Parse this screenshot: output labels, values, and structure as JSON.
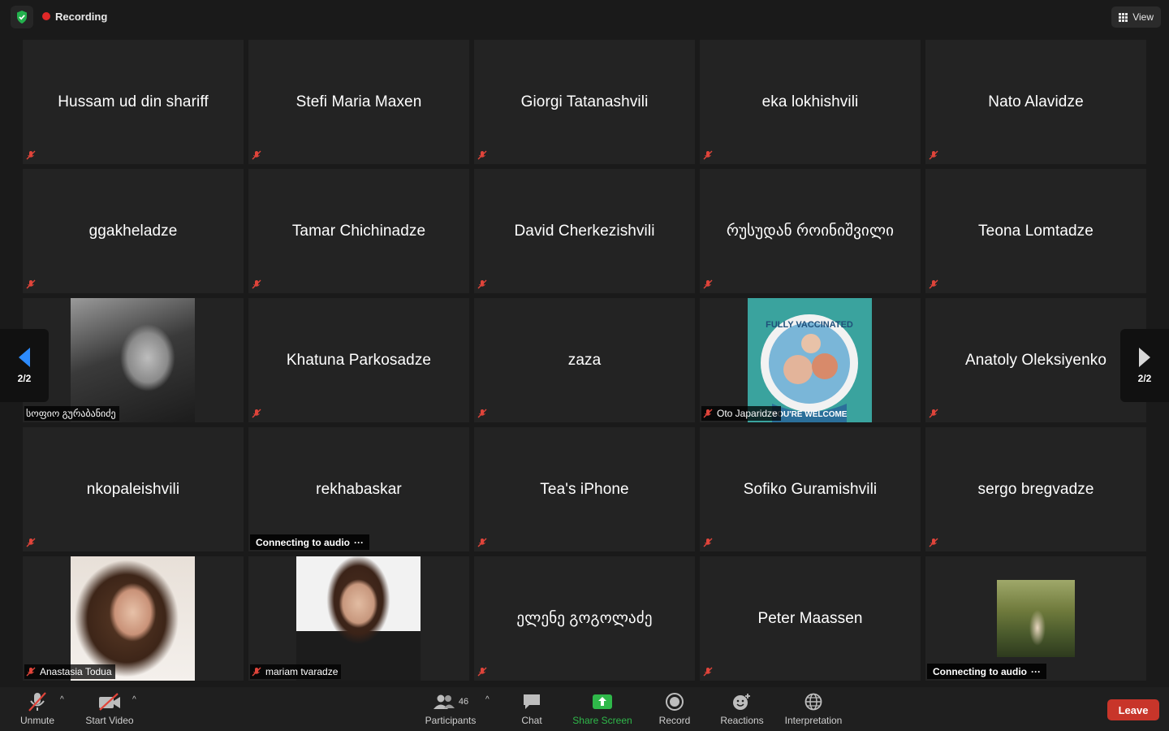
{
  "top_bar": {
    "security_icon": "shield-check-icon",
    "recording_label": "Recording",
    "view_label": "View"
  },
  "pager": {
    "left_label": "2/2",
    "right_label": "2/2"
  },
  "tiles": [
    {
      "name": "Hussam ud din shariff",
      "muted": true
    },
    {
      "name": "Stefi Maria Maxen",
      "muted": true
    },
    {
      "name": "Giorgi Tatanashvili",
      "muted": true
    },
    {
      "name": "eka lokhishvili",
      "muted": true
    },
    {
      "name": "Nato Alavidze",
      "muted": true
    },
    {
      "name": "ggakheladze",
      "muted": true
    },
    {
      "name": "Tamar Chichinadze",
      "muted": true
    },
    {
      "name": "David Cherkezishvili",
      "muted": true
    },
    {
      "name": "რუსუდან როინიშვილი",
      "muted": true
    },
    {
      "name": "Teona Lomtadze",
      "muted": true
    },
    {
      "name": "სოფიო გურაბანიძე",
      "muted": false,
      "photo": "bw-portrait"
    },
    {
      "name": "Khatuna Parkosadze",
      "muted": true
    },
    {
      "name": "zaza",
      "muted": true
    },
    {
      "name": "Oto Japaridze",
      "muted": true,
      "photo": "vaccinated-frame",
      "frame_text_top": "FULLY VACCINATED",
      "frame_text_bottom": "YOU'RE WELCOME"
    },
    {
      "name": "Anatoly Oleksiyenko",
      "muted": true
    },
    {
      "name": "nkopaleishvili",
      "muted": true
    },
    {
      "name": "rekhabaskar",
      "status": "Connecting to audio"
    },
    {
      "name": "Tea's iPhone",
      "muted": true
    },
    {
      "name": "Sofiko Guramishvili",
      "muted": true
    },
    {
      "name": "sergo bregvadze",
      "muted": true
    },
    {
      "name": "Anastasia Todua",
      "muted": true,
      "photo": "curly-portrait"
    },
    {
      "name": "mariam tvaradze",
      "muted": true,
      "photo": "white-bg-portrait"
    },
    {
      "name": "ელენე გოგოლაძე",
      "muted": true
    },
    {
      "name": "Peter Maassen",
      "muted": true
    },
    {
      "name": "",
      "status": "Connecting to audio",
      "photo": "garden-photo"
    }
  ],
  "toolbar": {
    "unmute_label": "Unmute",
    "start_video_label": "Start Video",
    "participants_label": "Participants",
    "participants_count": "46",
    "chat_label": "Chat",
    "share_screen_label": "Share Screen",
    "record_label": "Record",
    "reactions_label": "Reactions",
    "interpretation_label": "Interpretation",
    "leave_label": "Leave",
    "accent_green": "#2fb84a",
    "leave_color": "#c8352a"
  }
}
